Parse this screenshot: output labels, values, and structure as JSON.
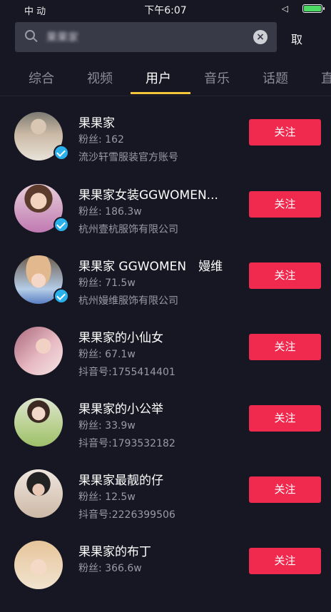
{
  "status_bar": {
    "carrier": "中    动",
    "time": "下午6:07",
    "location_indicator": "◁",
    "battery_color": "#4cd964"
  },
  "search": {
    "value": "果果家",
    "cancel_label": "取"
  },
  "tabs": [
    {
      "label": "综合",
      "active": false
    },
    {
      "label": "视频",
      "active": false
    },
    {
      "label": "用户",
      "active": true
    },
    {
      "label": "音乐",
      "active": false
    },
    {
      "label": "话题",
      "active": false
    },
    {
      "label": "直",
      "active": false
    }
  ],
  "users": [
    {
      "name": "果果家",
      "fans": "粉丝: 162",
      "sub": "流沙轩雪服装官方账号",
      "verified": true,
      "follow_label": "关注"
    },
    {
      "name": "果果家女装GGWOMEN...",
      "fans": "粉丝: 186.3w",
      "sub": "杭州壹杭服饰有限公司",
      "verified": true,
      "follow_label": "关注"
    },
    {
      "name": "果果家 GGWOMEN　嫚维",
      "fans": "粉丝: 71.5w",
      "sub": "杭州嫚维服饰有限公司",
      "verified": true,
      "follow_label": "关注"
    },
    {
      "name": "果果家的小仙女",
      "fans": "粉丝: 67.1w",
      "sub": "抖音号:1755414401",
      "verified": false,
      "follow_label": "关注"
    },
    {
      "name": "果果家的小公举",
      "fans": "粉丝: 33.9w",
      "sub": "抖音号:1793532182",
      "verified": false,
      "follow_label": "关注"
    },
    {
      "name": "果果家最靓的仔",
      "fans": "粉丝: 12.5w",
      "sub": "抖音号:2226399506",
      "verified": false,
      "follow_label": "关注"
    },
    {
      "name": "果果家的布丁",
      "fans": "粉丝: 366.6w",
      "sub": "",
      "verified": false,
      "follow_label": "关注"
    }
  ],
  "colors": {
    "background": "#161722",
    "follow_button": "#f0294f",
    "tab_indicator": "#f5c53a",
    "verified_badge": "#2ab1ec"
  }
}
